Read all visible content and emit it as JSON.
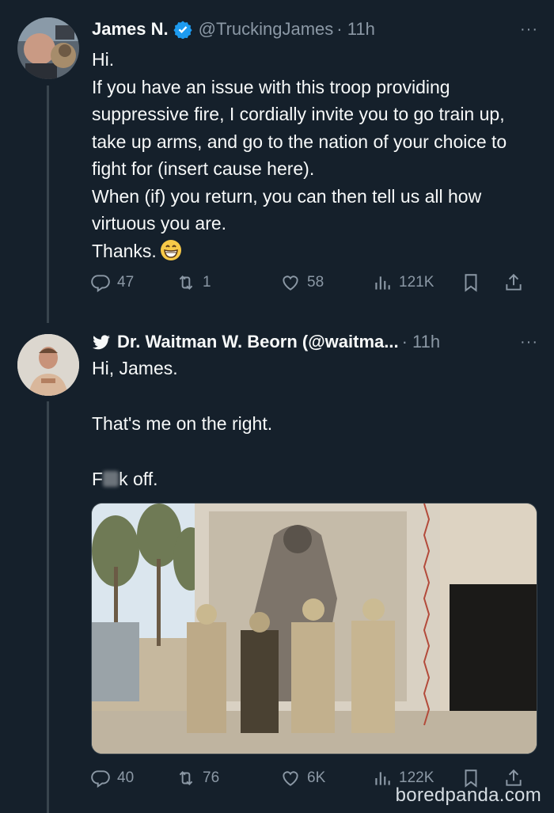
{
  "tweet1": {
    "name": "James N.",
    "handle": "@TruckingJames",
    "time": "· 11h",
    "more": "···",
    "lines": [
      "Hi.",
      "If you have an issue with this troop providing suppressive fire, I cordially invite you to go train up, take up arms, and go to the nation of your choice to fight for (insert cause here).",
      "When (if) you return, you can then tell us all how virtuous you are.",
      "Thanks."
    ],
    "stats": {
      "replies": "47",
      "retweets": "1",
      "likes": "58",
      "views": "121K"
    }
  },
  "tweet2": {
    "name": "Dr. Waitman W. Beorn (@waitma...",
    "time": "· 11h",
    "more": "···",
    "line1": "Hi, James.",
    "line2": "That's me on the right.",
    "line3_start": "F",
    "line3_end": "k off.",
    "stats": {
      "replies": "40",
      "retweets": "76",
      "likes": "6K",
      "views": "122K"
    }
  },
  "watermark": "boredpanda.com",
  "colors": {
    "background": "#15202b",
    "text": "#f7f9f9",
    "muted": "#8b98a5",
    "verified": "#1d9bf0",
    "line": "#38444d"
  },
  "icons": [
    "verified-badge-icon",
    "twitter-bird-icon",
    "reply-icon",
    "retweet-icon",
    "like-icon",
    "views-icon",
    "bookmark-icon",
    "share-icon",
    "more-icon",
    "grin-emoji"
  ]
}
